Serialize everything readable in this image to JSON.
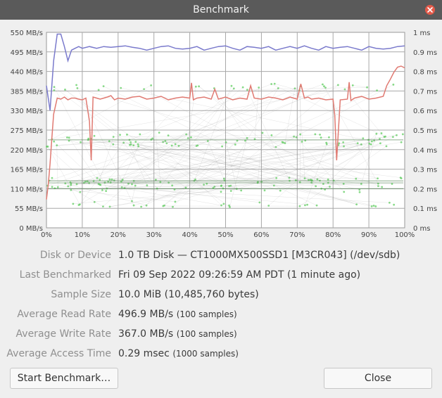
{
  "window": {
    "title": "Benchmark"
  },
  "chart_data": {
    "type": "line",
    "title": "",
    "xlabel": "",
    "ylabel": "",
    "y_left_ticks": [
      "0 MB/s",
      "55 MB/s",
      "110 MB/s",
      "165 MB/s",
      "220 MB/s",
      "275 MB/s",
      "330 MB/s",
      "385 MB/s",
      "440 MB/s",
      "495 MB/s",
      "550 MB/s"
    ],
    "y_right_ticks": [
      "0 ms",
      "0.1 ms",
      "0.2 ms",
      "0.3 ms",
      "0.4 ms",
      "0.5 ms",
      "0.6 ms",
      "0.7 ms",
      "0.8 ms",
      "0.9 ms",
      "1 ms"
    ],
    "x_ticks": [
      "0%",
      "10%",
      "20%",
      "30%",
      "40%",
      "50%",
      "60%",
      "70%",
      "80%",
      "90%",
      "100%"
    ],
    "xlim": [
      0,
      100
    ],
    "ylim_left": [
      0,
      550
    ],
    "ylim_right": [
      0,
      1
    ],
    "grid": true,
    "colors": {
      "read": "#7a7acc",
      "write": "#e07a72",
      "access": "#55cc55"
    },
    "series": [
      {
        "kind": "read",
        "axis": "left",
        "unit": "MB/s",
        "x": [
          0,
          1,
          2,
          3,
          4,
          5,
          6,
          7,
          8,
          9,
          10,
          12,
          14,
          16,
          18,
          20,
          22,
          24,
          26,
          28,
          30,
          32,
          34,
          36,
          38,
          40,
          42,
          44,
          46,
          48,
          50,
          52,
          54,
          56,
          58,
          60,
          62,
          64,
          66,
          68,
          70,
          72,
          74,
          76,
          78,
          80,
          82,
          84,
          86,
          88,
          90,
          92,
          94,
          96,
          98,
          100
        ],
        "values": [
          400,
          330,
          470,
          545,
          545,
          510,
          470,
          500,
          505,
          510,
          505,
          510,
          505,
          510,
          508,
          510,
          512,
          508,
          505,
          500,
          505,
          510,
          512,
          505,
          503,
          505,
          510,
          500,
          505,
          510,
          512,
          505,
          500,
          510,
          508,
          505,
          510,
          500,
          505,
          510,
          505,
          512,
          505,
          500,
          510,
          505,
          508,
          510,
          505,
          500,
          510,
          505,
          503,
          505,
          510,
          512
        ]
      },
      {
        "kind": "write",
        "axis": "left",
        "unit": "MB/s",
        "x": [
          0,
          0.5,
          1,
          1.5,
          2,
          3,
          4,
          5,
          6,
          7,
          8,
          9,
          10,
          11,
          12,
          12.5,
          13,
          14,
          15,
          16,
          17,
          18,
          19,
          20,
          22,
          24,
          26,
          28,
          30,
          32,
          34,
          36,
          38,
          40,
          40.5,
          41,
          42,
          44,
          46,
          47,
          48,
          50,
          52,
          54,
          56,
          57,
          58,
          60,
          62,
          64,
          66,
          68,
          70,
          71,
          72,
          73,
          74,
          76,
          78,
          80,
          80.5,
          81,
          82,
          84,
          84.5,
          85,
          86,
          88,
          90,
          92,
          94,
          95,
          96,
          97,
          98,
          99,
          100
        ],
        "values": [
          80,
          120,
          180,
          250,
          320,
          365,
          362,
          368,
          360,
          365,
          365,
          362,
          360,
          365,
          300,
          190,
          368,
          365,
          362,
          365,
          368,
          372,
          360,
          365,
          362,
          368,
          370,
          362,
          365,
          370,
          360,
          365,
          368,
          365,
          408,
          360,
          365,
          368,
          362,
          390,
          362,
          368,
          360,
          365,
          362,
          400,
          365,
          362,
          368,
          365,
          360,
          368,
          362,
          405,
          365,
          368,
          362,
          365,
          360,
          362,
          315,
          190,
          360,
          362,
          410,
          358,
          365,
          370,
          362,
          365,
          370,
          400,
          418,
          438,
          452,
          455,
          450
        ]
      },
      {
        "kind": "access",
        "axis": "right",
        "unit": "ms",
        "sample_count": 1000,
        "band_levels_ms": [
          0.12,
          0.2,
          0.23,
          0.24,
          0.43,
          0.45,
          0.47,
          0.72
        ],
        "note_levels": [
          0.12,
          0.2,
          0.23,
          0.24,
          0.43,
          0.45,
          0.47,
          0.72
        ]
      }
    ]
  },
  "info": {
    "rows": [
      {
        "label": "Disk or Device",
        "value": "1.0 TB Disk — CT1000MX500SSD1 [M3CR043] (/dev/sdb)",
        "extra": ""
      },
      {
        "label": "Last Benchmarked",
        "value": "Fri 09 Sep 2022 09:26:59 AM PDT (1 minute ago)",
        "extra": ""
      },
      {
        "label": "Sample Size",
        "value": "10.0 MiB (10,485,760 bytes)",
        "extra": ""
      },
      {
        "label": "Average Read Rate",
        "value": "496.9 MB/s",
        "extra": "(100 samples)"
      },
      {
        "label": "Average Write Rate",
        "value": "367.0 MB/s",
        "extra": "(100 samples)"
      },
      {
        "label": "Average Access Time",
        "value": "0.29 msec",
        "extra": "(1000 samples)"
      }
    ]
  },
  "buttons": {
    "start_benchmark": "Start Benchmark…",
    "close": "Close"
  }
}
